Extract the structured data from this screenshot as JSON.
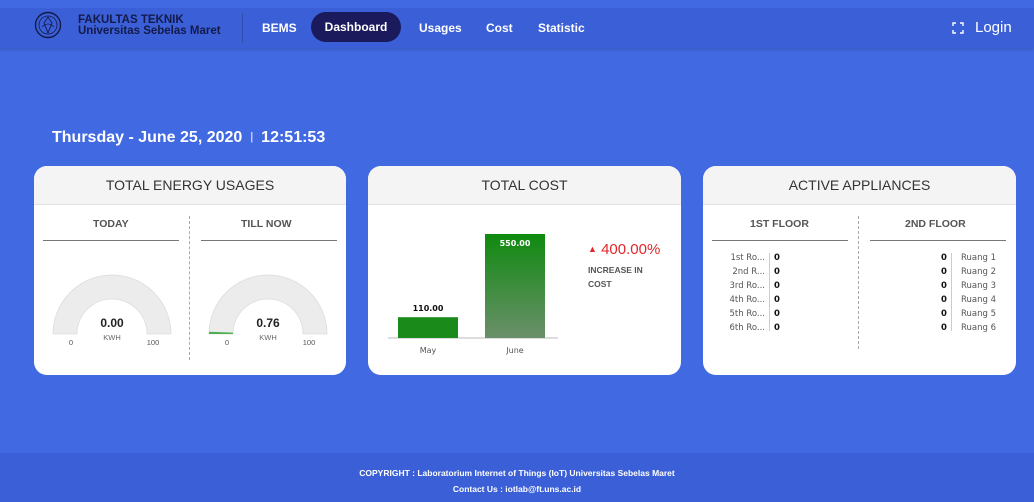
{
  "header": {
    "brand_line1": "FAKULTAS TEKNIK",
    "brand_line2": "Universitas Sebelas Maret",
    "nav": [
      "BEMS",
      "Dashboard",
      "Usages",
      "Cost",
      "Statistic"
    ],
    "active_nav": "Dashboard",
    "login_label": "Login",
    "icons": [
      "university-seal-icon",
      "fullscreen-icon"
    ]
  },
  "datetime": {
    "date": "Thursday - June 25, 2020",
    "separator": "|",
    "time": "12:51:53"
  },
  "energy": {
    "title": "TOTAL ENERGY USAGES",
    "today": {
      "label": "TODAY",
      "value": "0.00",
      "unit": "KWH",
      "min": "0",
      "max": "100",
      "fraction": 0.0
    },
    "till_now": {
      "label": "TILL NOW",
      "value": "0.76",
      "unit": "KWH",
      "min": "0",
      "max": "100",
      "fraction": 0.0076
    }
  },
  "cost": {
    "title": "TOTAL COST",
    "change_pct": "400.00%",
    "change_label_1": "INCREASE IN",
    "change_label_2": "COST",
    "trend_color": "#e0262b"
  },
  "chart_data": {
    "type": "bar",
    "categories": [
      "May",
      "June"
    ],
    "values": [
      110.0,
      550.0
    ],
    "value_labels": [
      "110.00",
      "550.00"
    ],
    "ylim": [
      0,
      550
    ]
  },
  "appliances": {
    "title": "ACTIVE APPLIANCES",
    "floor1": {
      "label": "1ST FLOOR",
      "rooms": [
        {
          "name": "1st Ro...",
          "value": "0"
        },
        {
          "name": "2nd R...",
          "value": "0"
        },
        {
          "name": "3rd Ro...",
          "value": "0"
        },
        {
          "name": "4th Ro...",
          "value": "0"
        },
        {
          "name": "5th Ro...",
          "value": "0"
        },
        {
          "name": "6th Ro...",
          "value": "0"
        }
      ]
    },
    "floor2": {
      "label": "2ND FLOOR",
      "rooms": [
        {
          "name": "Ruang 1",
          "value": "0"
        },
        {
          "name": "Ruang 2",
          "value": "0"
        },
        {
          "name": "Ruang 3",
          "value": "0"
        },
        {
          "name": "Ruang 4",
          "value": "0"
        },
        {
          "name": "Ruang 5",
          "value": "0"
        },
        {
          "name": "Ruang 6",
          "value": "0"
        }
      ]
    }
  },
  "footer": {
    "copyright": "COPYRIGHT : Laboratorium Internet of Things (IoT) Universitas Sebelas Maret",
    "contact": "Contact Us : iotlab@ft.uns.ac.id"
  },
  "colors": {
    "background": "#4169e1",
    "navbar": "#3a5fd6",
    "active_nav": "#1a1a5c",
    "bar_green": "#1a8a1a",
    "increase_red": "#e0262b"
  }
}
